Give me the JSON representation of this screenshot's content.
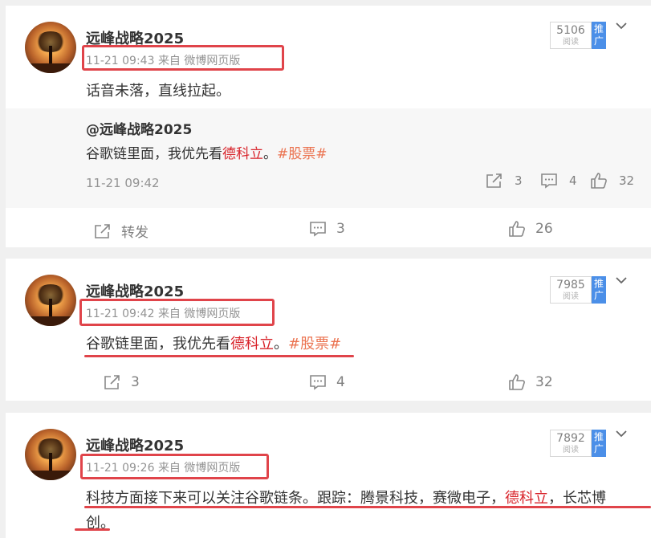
{
  "posts": [
    {
      "username": "远峰战略2025",
      "time": "11-21 09:43",
      "source": "来自 微博网页版",
      "views": "5106",
      "views_label": "阅读",
      "promote_label": "推广",
      "text": "话音未落，直线拉起。",
      "repost": {
        "author": "@远峰战略2025",
        "text_pre": "谷歌链里面，我优先看",
        "text_highlight": "德科立",
        "text_mid": "。",
        "topic": "#股票#",
        "time": "11-21 09:42",
        "reposts": "3",
        "comments": "4",
        "likes": "32"
      },
      "actions": {
        "repost_label": "转发",
        "comments": "3",
        "likes": "26"
      }
    },
    {
      "username": "远峰战略2025",
      "time": "11-21 09:42",
      "source": "来自 微博网页版",
      "views": "7985",
      "views_label": "阅读",
      "promote_label": "推广",
      "text_pre": "谷歌链里面，我优先看",
      "text_highlight": "德科立",
      "text_mid": "。",
      "topic": "#股票#",
      "actions": {
        "reposts": "3",
        "comments": "4",
        "likes": "32"
      }
    },
    {
      "username": "远峰战略2025",
      "time": "11-21 09:26",
      "source": "来自 微博网页版",
      "views": "7892",
      "views_label": "阅读",
      "promote_label": "推广",
      "text_line1_pre": "科技方面接下来可以关注谷歌链条。跟踪：腾景科技，赛微电子，",
      "text_highlight": "德科立",
      "text_line1_post": "，长芯博",
      "text_line2": "创。"
    }
  ],
  "colors": {
    "highlight_box": "#e0444a",
    "topic": "#eb7350",
    "stock_red": "#d8232a",
    "promote_blue": "#4b8fe8"
  },
  "icons": [
    "avatar-tree",
    "repost-icon",
    "comment-icon",
    "like-icon",
    "chevron-down-icon"
  ]
}
